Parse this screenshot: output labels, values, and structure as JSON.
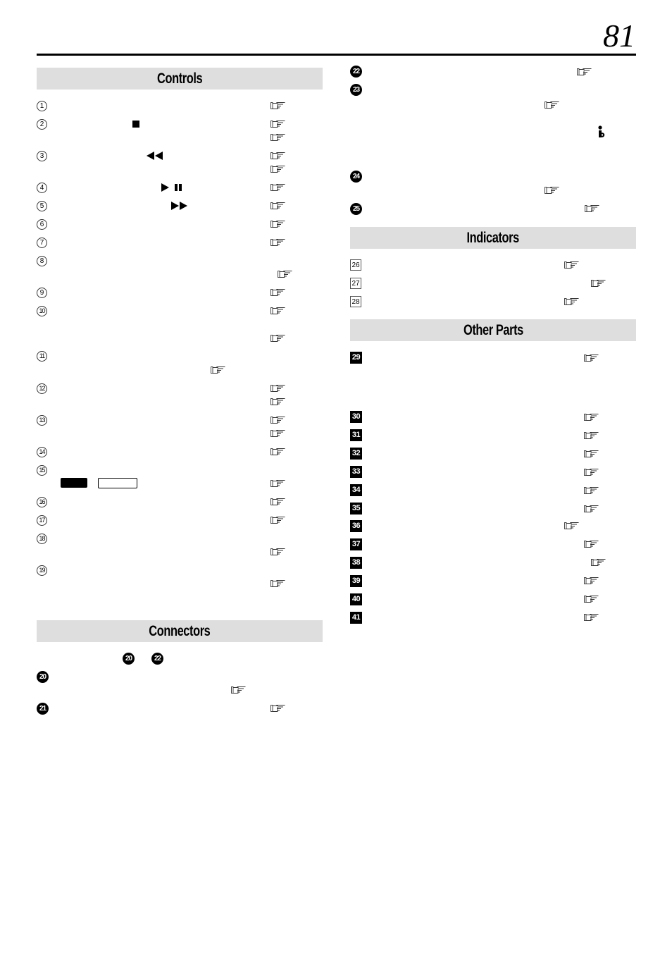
{
  "page": {
    "number": "81"
  },
  "sections": {
    "controls": {
      "title": "Controls",
      "items": [
        {
          "marker": "1",
          "refs": 1
        },
        {
          "marker": "2",
          "refs": 2,
          "symbol": "stop-icon"
        },
        {
          "marker": "3",
          "refs": 2,
          "symbol": "rewind-icon"
        },
        {
          "marker": "4",
          "refs": 1,
          "symbol": "play-pause-icon"
        },
        {
          "marker": "5",
          "refs": 1,
          "symbol": "fast-forward-icon"
        },
        {
          "marker": "6",
          "refs": 1
        },
        {
          "marker": "7",
          "refs": 1
        },
        {
          "marker": "8",
          "refs": 1
        },
        {
          "marker": "9",
          "refs": 1
        },
        {
          "marker": "10",
          "refs": 2
        },
        {
          "marker": "11",
          "refs": 1
        },
        {
          "marker": "12",
          "refs": 2
        },
        {
          "marker": "13",
          "refs": 2
        },
        {
          "marker": "14",
          "refs": 1
        },
        {
          "marker": "15",
          "refs": 1,
          "symbol": "mode-buttons"
        },
        {
          "marker": "16",
          "refs": 1
        },
        {
          "marker": "17",
          "refs": 1
        },
        {
          "marker": "18",
          "refs": 1
        },
        {
          "marker": "19",
          "refs": 1
        }
      ]
    },
    "connectors": {
      "title": "Connectors",
      "intro_markers": [
        "20",
        "22"
      ],
      "items": [
        {
          "marker": "20",
          "refs": 1
        },
        {
          "marker": "21",
          "refs": 1
        },
        {
          "marker": "22",
          "refs": 1
        },
        {
          "marker": "23",
          "refs": 1,
          "symbol": "info-icon"
        },
        {
          "marker": "24",
          "refs": 1
        },
        {
          "marker": "25",
          "refs": 1
        }
      ]
    },
    "indicators": {
      "title": "Indicators",
      "items": [
        {
          "marker": "26",
          "refs": 1
        },
        {
          "marker": "27",
          "refs": 1
        },
        {
          "marker": "28",
          "refs": 1
        }
      ]
    },
    "other_parts": {
      "title": "Other Parts",
      "items": [
        {
          "marker": "29",
          "refs": 1
        },
        {
          "marker": "30",
          "refs": 1
        },
        {
          "marker": "31",
          "refs": 1
        },
        {
          "marker": "32",
          "refs": 1
        },
        {
          "marker": "33",
          "refs": 1
        },
        {
          "marker": "34",
          "refs": 1
        },
        {
          "marker": "35",
          "refs": 1
        },
        {
          "marker": "36",
          "refs": 1
        },
        {
          "marker": "37",
          "refs": 1
        },
        {
          "marker": "38",
          "refs": 1
        },
        {
          "marker": "39",
          "refs": 1
        },
        {
          "marker": "40",
          "refs": 1
        },
        {
          "marker": "41",
          "refs": 1
        }
      ]
    }
  },
  "icons": {
    "reference": "pointing-hand-icon",
    "info": "info-icon"
  }
}
